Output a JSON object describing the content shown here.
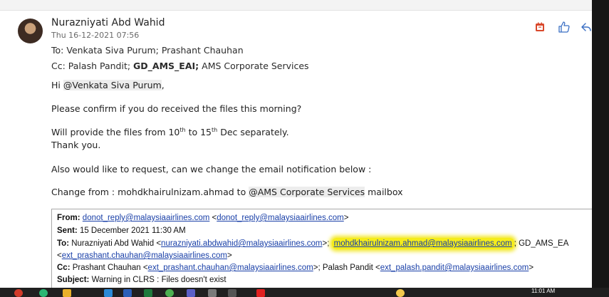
{
  "email": {
    "sender": "Nurazniyati Abd Wahid",
    "date": "Thu 16-12-2021 07:56",
    "to_label": "To:",
    "to_value": "Venkata Siva Purum; Prashant Chauhan",
    "cc_label": "Cc:",
    "cc_part1": "Palash Pandit;",
    "cc_bold": "GD_AMS_EAI;",
    "cc_part2": "AMS Corporate Services",
    "greeting_prefix": "Hi",
    "greeting_mention": "@Venkata Siva Purum",
    "greeting_suffix": ",",
    "line1": "Please confirm if you do received the files this morning?",
    "line2_a": "Will provide the files from 10",
    "line2_sup1": "th",
    "line2_b": " to 15",
    "line2_sup2": "th",
    "line2_c": " Dec separately.",
    "line3": "Thank you.",
    "line4": "Also would like to request, can we change the email notification below :",
    "line5_a": "Change from : mohdkhairulnizam.ahmad to ",
    "line5_mention": "@AMS Corporate Services",
    "line5_b": " mailbox"
  },
  "forwarded": {
    "from_label": "From:",
    "from_link1": "donot_reply@malaysiaairlines.com",
    "from_lt": " <",
    "from_link2": "donot_reply@malaysiaairlines.com",
    "from_gt": ">",
    "sent_label": "Sent:",
    "sent_value": " 15 December 2021 11:30 AM",
    "to_label": "To:",
    "to_name1": " Nurazniyati Abd Wahid <",
    "to_link1": "nurazniyati.abdwahid@malaysiaairlines.com",
    "to_sep1": ">; ",
    "to_highlight": "mohdkhairulnizam.ahmad@malaysiaairlines.com",
    "to_sep2": "; GD_AMS_EA",
    "to_lt2": "<",
    "to_link2": "ext_prashant.chauhan@malaysiaairlines.com",
    "to_gt2": ">",
    "cc_label": "Cc:",
    "cc_name1": " Prashant Chauhan <",
    "cc_link1": "ext_prashant.chauhan@malaysiaairlines.com",
    "cc_mid": ">; Palash Pandit <",
    "cc_link2": "ext_palash.pandit@malaysiaairlines.com",
    "cc_gt": ">",
    "subject_label": "Subject:",
    "subject_value": " Warning in CLRS : Files doesn't exist"
  },
  "taskbar": {
    "clock": "11:01 AM"
  },
  "icons": [
    "calendar-icon",
    "thumbs-up-icon",
    "reply-icon"
  ],
  "colors": {
    "link": "#1a40a8",
    "highlight": "#f5ec1a",
    "mention_bg": "#ededed"
  }
}
